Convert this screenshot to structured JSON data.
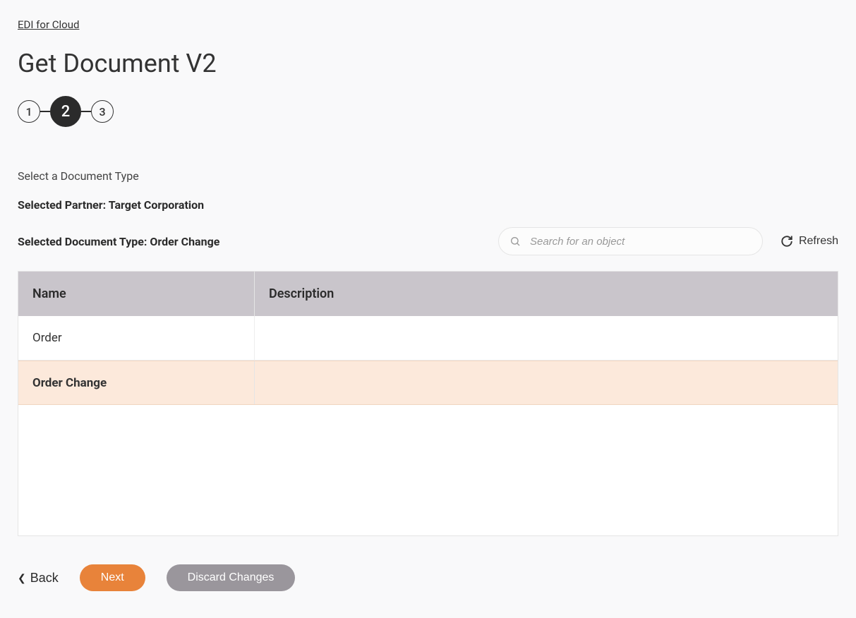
{
  "breadcrumb": "EDI for Cloud",
  "page_title": "Get Document V2",
  "stepper": {
    "steps": [
      "1",
      "2",
      "3"
    ],
    "active_index": 1
  },
  "section_label": "Select a Document Type",
  "selected_partner_label": "Selected Partner: Target Corporation",
  "selected_doc_type_label": "Selected Document Type: Order Change",
  "search": {
    "placeholder": "Search for an object",
    "value": ""
  },
  "refresh_label": "Refresh",
  "table": {
    "headers": {
      "name": "Name",
      "description": "Description"
    },
    "rows": [
      {
        "name": "Order",
        "description": "",
        "selected": false
      },
      {
        "name": "Order Change",
        "description": "",
        "selected": true
      }
    ]
  },
  "buttons": {
    "back": "Back",
    "next": "Next",
    "discard": "Discard Changes"
  }
}
